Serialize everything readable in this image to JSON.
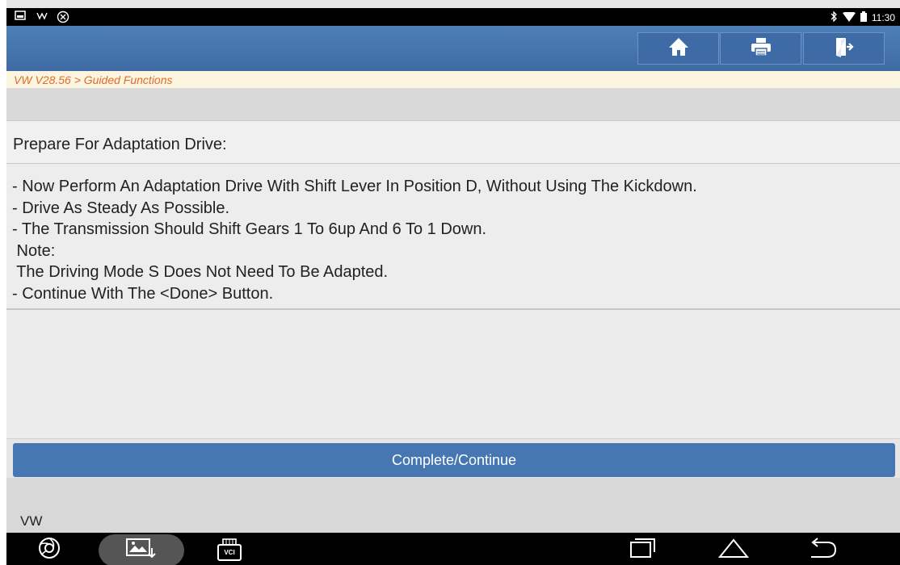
{
  "status_bar": {
    "time": "11:30",
    "left_icons": [
      "gallery-notification-icon",
      "usb-debug-icon",
      "sync-icon"
    ],
    "right_icons": [
      "bluetooth-icon",
      "wifi-icon",
      "battery-icon"
    ]
  },
  "toolbar": {
    "buttons": [
      {
        "icon": "home-icon"
      },
      {
        "icon": "print-icon"
      },
      {
        "icon": "exit-icon"
      }
    ]
  },
  "breadcrumb": "VW V28.56 > Guided Functions",
  "prepare_title": "Prepare For Adaptation Drive:",
  "instructions": [
    "- Now Perform An Adaptation Drive With Shift Lever In Position D, Without Using The Kickdown.",
    "- Drive As Steady As Possible.",
    "- The Transmission Should Shift Gears 1 To 6up And 6 To 1 Down.",
    " Note:",
    " The Driving Mode S Does Not Need To Be Adapted.",
    "- Continue With The <Done> Button."
  ],
  "complete_button": "Complete/Continue",
  "footer_label": "VW",
  "nav_bar": {
    "vci_label": "VCI",
    "icons": [
      "browser-icon",
      "screenshot-icon",
      "vci-icon",
      "recent-apps-icon",
      "home-nav-icon",
      "back-icon"
    ]
  },
  "colors": {
    "toolbar": "#4a78b1",
    "breadcrumb_text": "#e26a2c",
    "breadcrumb_bg": "#fcf6e0",
    "button": "#4677b3"
  }
}
